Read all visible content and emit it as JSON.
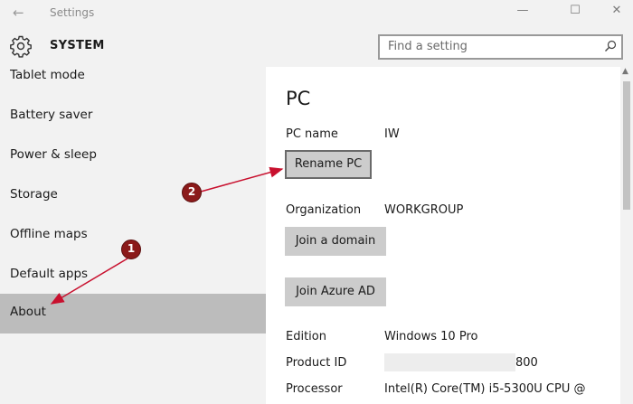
{
  "window": {
    "title": "Settings",
    "back_glyph": "←",
    "minimize_glyph": "—",
    "maximize_glyph": "☐",
    "close_glyph": "✕"
  },
  "header": {
    "section_title": "SYSTEM",
    "search_placeholder": "Find a setting"
  },
  "sidebar": {
    "items": [
      {
        "label": "Tablet mode"
      },
      {
        "label": "Battery saver"
      },
      {
        "label": "Power & sleep"
      },
      {
        "label": "Storage"
      },
      {
        "label": "Offline maps"
      },
      {
        "label": "Default apps"
      },
      {
        "label": "About",
        "selected": true
      }
    ]
  },
  "main": {
    "title": "PC",
    "pc_name_label": "PC name",
    "pc_name_value": "IW",
    "rename_button": "Rename PC",
    "organization_label": "Organization",
    "organization_value": "WORKGROUP",
    "join_domain_button": "Join a domain",
    "join_azure_button": "Join Azure AD",
    "edition_label": "Edition",
    "edition_value": "Windows 10 Pro",
    "product_id_label": "Product ID",
    "product_id_visible": "800",
    "processor_label": "Processor",
    "processor_value": "Intel(R) Core(TM) i5-5300U CPU @"
  },
  "annotations": [
    {
      "number": "1"
    },
    {
      "number": "2"
    }
  ],
  "colors": {
    "chrome_bg": "#f2f2f2",
    "selected_item": "#bcbcbc",
    "button_bg": "#cccccc",
    "annotation_red": "#c8102e",
    "marker_fill": "#8b1a1a"
  }
}
